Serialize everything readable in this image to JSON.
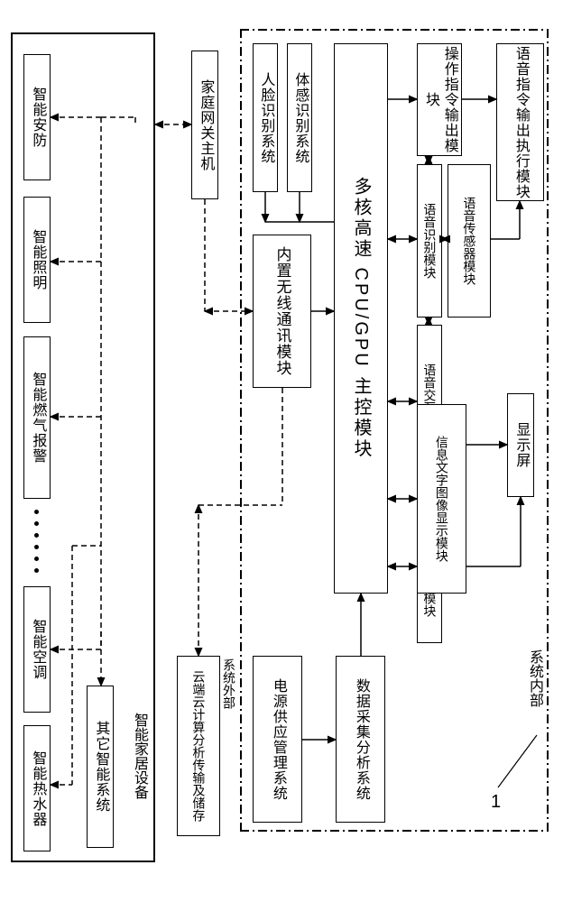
{
  "system_internal_box_label": "系统内部",
  "ref1": "1",
  "left_group": {
    "face_recognition": "人脸识别系统",
    "body_sensing": "体感识别系统",
    "wireless_comm": "内置无线通讯模块",
    "power_mgmt": "电源供应管理系统"
  },
  "center": {
    "cpu": "多核高速\nCPU/GPU\n主控模块",
    "data_collect": "数据采集分析系统"
  },
  "right_group": {
    "op_cmd": "操作指令输出模块",
    "voice_recog": "语音识别模块",
    "voice_sensor": "语音传感器模块",
    "voice_interact": "语音交互系统",
    "info_display": "信息文字图像显示模块",
    "touch_display": "触摸指示显示模块",
    "voice_cmd_exec": "语音指令输出执行模块",
    "display_screen": "显示屏"
  },
  "external": {
    "gateway": "家庭网关主机",
    "cloud": "云端云计算分析传输及储存",
    "cloud_label": "系统外部"
  },
  "devices_box_label": "智能家居设备",
  "devices": {
    "security": "智能安防",
    "lighting": "智能照明",
    "gas_alarm": "智能燃气报警",
    "aircon": "智能空调",
    "water_heater": "智能热水器",
    "other": "其它智能系统"
  }
}
